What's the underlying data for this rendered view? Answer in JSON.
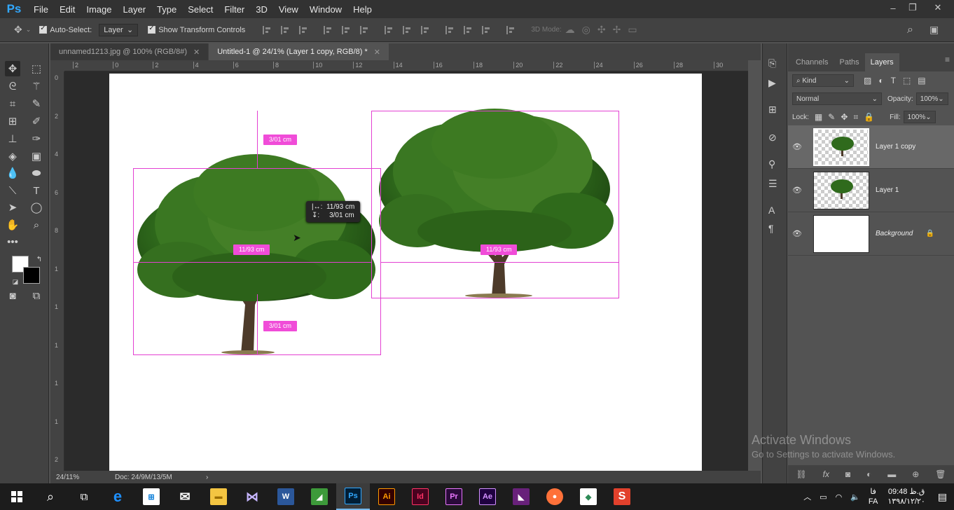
{
  "app": {
    "logo": "Ps"
  },
  "menu": [
    "File",
    "Edit",
    "Image",
    "Layer",
    "Type",
    "Select",
    "Filter",
    "3D",
    "View",
    "Window",
    "Help"
  ],
  "window_controls": {
    "minimize": "–",
    "restore": "❐",
    "close": "✕"
  },
  "options": {
    "auto_select_label": "Auto-Select:",
    "auto_select_value": "Layer",
    "transform_label": "Show Transform Controls",
    "mode_3d": "3D Mode:"
  },
  "tabs": [
    {
      "title": "unnamed1213.jpg @ 100% (RGB/8#)",
      "close": "✕"
    },
    {
      "title": "Untitled-1 @ 24/1% (Layer 1 copy, RGB/8) *",
      "close": "✕"
    }
  ],
  "ruler_h": [
    "2",
    "0",
    "2",
    "4",
    "6",
    "8",
    "10",
    "12",
    "14",
    "16",
    "18",
    "20",
    "22",
    "24",
    "26",
    "28",
    "30"
  ],
  "ruler_v": [
    "0",
    "2",
    "4",
    "6",
    "8",
    "1",
    "1",
    "1",
    "1",
    "1",
    "2"
  ],
  "measure": {
    "top_tag": "3/01 cm",
    "left_width_tag": "11/93 cm",
    "bottom_tag": "3/01 cm",
    "right_width_tag": "11/93 cm",
    "tooltip_line1": "11/93 cm",
    "tooltip_line2": "3/01 cm",
    "tooltip_icon1": "|↔:",
    "tooltip_icon2": "↧:"
  },
  "status": {
    "zoom": "24/11%",
    "doc": "Doc: 24/9M/13/5M",
    "arrow": "›"
  },
  "panel": {
    "tabs": [
      "Channels",
      "Paths",
      "Layers"
    ],
    "kind": "Kind",
    "blend": "Normal",
    "opacity_label": "Opacity:",
    "opacity": "100%",
    "lock_label": "Lock:",
    "fill_label": "Fill:",
    "fill": "100%",
    "layers": [
      {
        "name": "Layer 1 copy",
        "active": true,
        "type": "tree"
      },
      {
        "name": "Layer 1",
        "active": false,
        "type": "tree"
      },
      {
        "name": "Background",
        "active": false,
        "type": "bg"
      }
    ]
  },
  "watermark": {
    "title": "Activate Windows",
    "sub": "Go to Settings to activate Windows."
  },
  "taskbar": {
    "apps": [
      {
        "name": "task-view"
      },
      {
        "name": "edge",
        "label": "e",
        "color": "#1e90ff"
      },
      {
        "name": "store"
      },
      {
        "name": "mail"
      },
      {
        "name": "explorer"
      },
      {
        "name": "vs"
      },
      {
        "name": "word",
        "label": "W",
        "color": "#2b579a"
      },
      {
        "name": "camtasia"
      },
      {
        "name": "photoshop",
        "label": "Ps",
        "color": "#31a8ff",
        "bg": "#001e36"
      },
      {
        "name": "illustrator",
        "label": "Ai",
        "color": "#ff9a00",
        "bg": "#330000"
      },
      {
        "name": "indesign",
        "label": "Id",
        "color": "#ff3366",
        "bg": "#49021f"
      },
      {
        "name": "premiere",
        "label": "Pr",
        "color": "#ea77ff",
        "bg": "#2a0a3a"
      },
      {
        "name": "aftereffects",
        "label": "Ae",
        "color": "#d291ff",
        "bg": "#1f0040"
      },
      {
        "name": "vs-app"
      },
      {
        "name": "firefox"
      },
      {
        "name": "app-diamond"
      },
      {
        "name": "app-s",
        "label": "S",
        "color": "#fff",
        "bg": "#e2412c"
      }
    ],
    "lang_top": "فا",
    "lang_bottom": "FA",
    "time": "09:48 ق.ظ",
    "date": "۱۳۹۸/۱۲/۲۰"
  }
}
